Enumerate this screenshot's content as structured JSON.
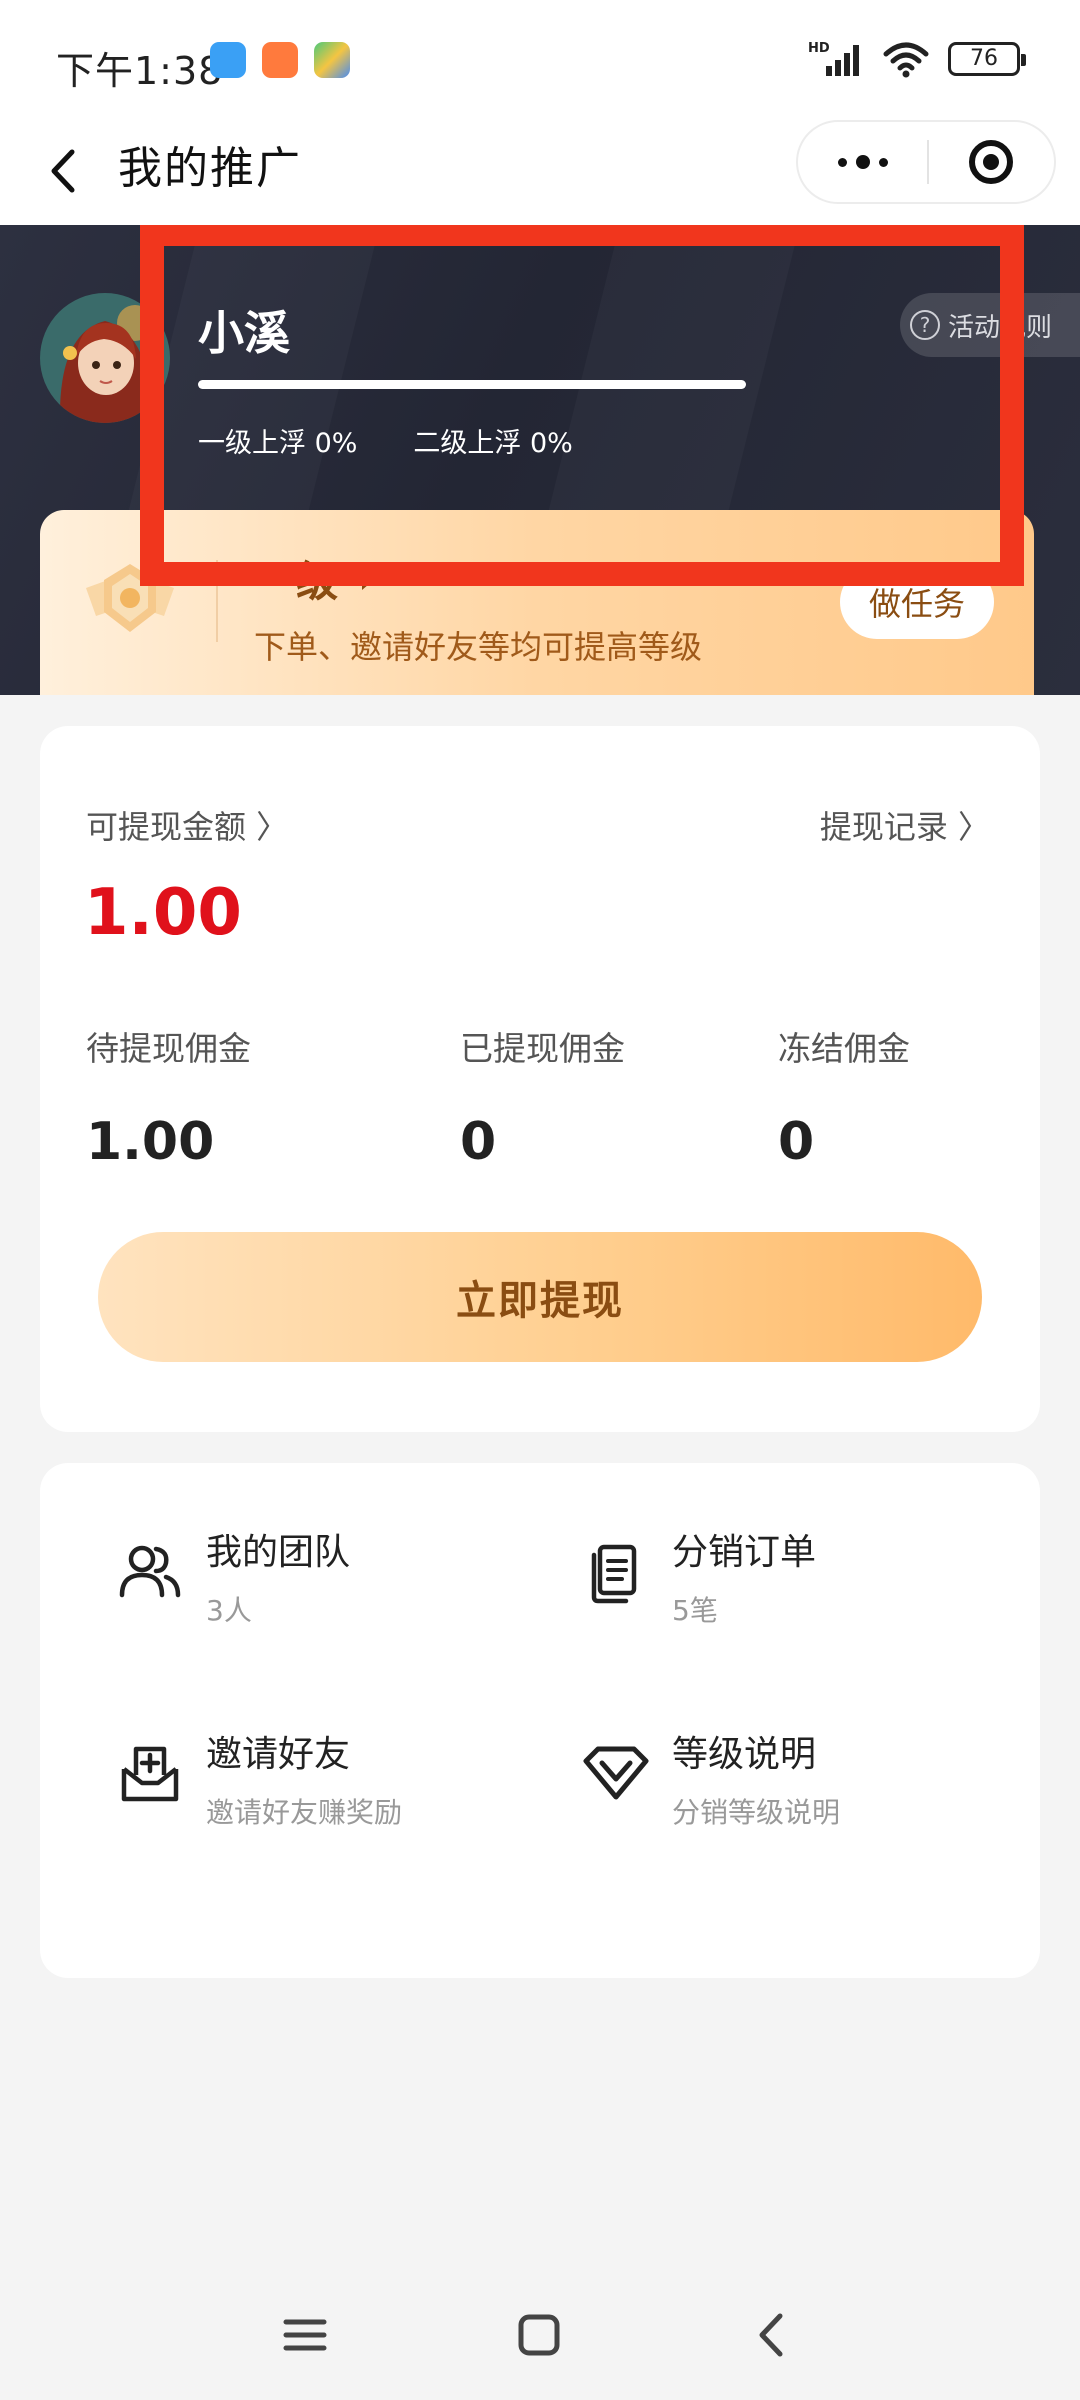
{
  "status_bar": {
    "time": "下午1:38",
    "network": "HD",
    "battery": "76"
  },
  "nav": {
    "title": "我的推广"
  },
  "profile": {
    "name": "小溪",
    "rules_label": "活动规则",
    "progress": 1.0,
    "float_level1": "一级上浮 0%",
    "float_level2": "二级上浮 0%"
  },
  "level_card": {
    "level_name": "一级",
    "description": "下单、邀请好友等均可提高等级",
    "task_button": "做任务"
  },
  "withdraw": {
    "available_label": "可提现金额 〉",
    "record_label": "提现记录 〉",
    "available_amount": "1.00",
    "stats": [
      {
        "label": "待提现佣金",
        "value": "1.00"
      },
      {
        "label": "已提现佣金",
        "value": "0"
      },
      {
        "label": "冻结佣金",
        "value": "0"
      }
    ],
    "button_label": "立即提现"
  },
  "entries": [
    {
      "title": "我的团队",
      "sub": "3人",
      "icon": "team-icon"
    },
    {
      "title": "分销订单",
      "sub": "5笔",
      "icon": "order-icon"
    },
    {
      "title": "邀请好友",
      "sub": "邀请好友赚奖励",
      "icon": "invite-icon"
    },
    {
      "title": "等级说明",
      "sub": "分销等级说明",
      "icon": "diamond-icon"
    }
  ],
  "colors": {
    "accent_red": "#e0111b",
    "highlight": "#f1361d",
    "gold_text": "#8a4d12",
    "hero_bg": "#262936"
  }
}
